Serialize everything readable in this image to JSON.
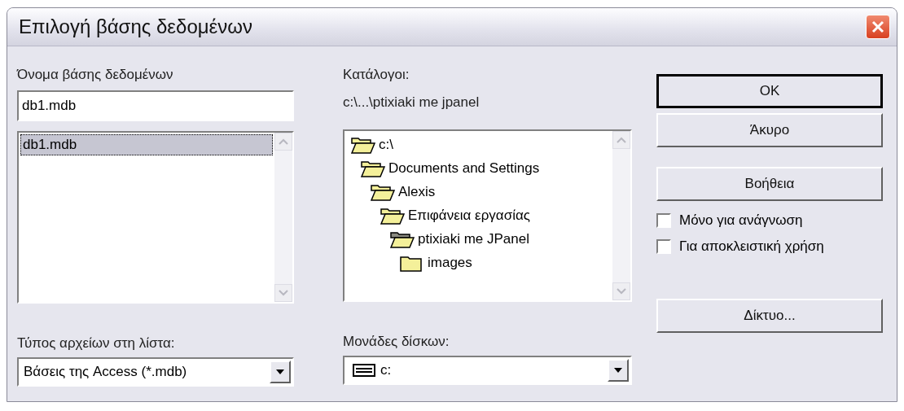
{
  "window": {
    "title": "Επιλογή βάσης δεδομένων"
  },
  "database_name": {
    "label": "Όνομα βάσης δεδομένων",
    "value": "db1.mdb",
    "files": [
      {
        "label": "db1.mdb",
        "selected": true
      }
    ]
  },
  "directories": {
    "label": "Κατάλογοι:",
    "path": "c:\\...\\ptixiaki me jpanel",
    "tree": [
      {
        "label": "c:\\",
        "kind": "open",
        "children": [
          {
            "label": "Documents and Settings",
            "kind": "open",
            "children": [
              {
                "label": "Alexis",
                "kind": "open",
                "children": [
                  {
                    "label": "Επιφάνεια εργασίας",
                    "kind": "open",
                    "children": [
                      {
                        "label": "ptixiaki me JPanel",
                        "kind": "current",
                        "children": [
                          {
                            "label": "images",
                            "kind": "closed"
                          }
                        ]
                      }
                    ]
                  }
                ]
              }
            ]
          }
        ]
      }
    ]
  },
  "file_type": {
    "label": "Τύπος αρχείων στη λίστα:",
    "value": "Βάσεις της Access (*.mdb)"
  },
  "drives": {
    "label": "Μονάδες δίσκων:",
    "value": "c:"
  },
  "buttons": [
    {
      "label": "OK",
      "default": true
    },
    {
      "label": "Άκυρο",
      "default": false
    },
    {
      "label": "Βοήθεια",
      "default": false
    }
  ],
  "options": [
    {
      "label": "Μόνο για ανάγνωση",
      "checked": false
    },
    {
      "label": "Για αποκλειστική χρήση",
      "checked": false
    }
  ],
  "network_button": {
    "label": "Δίκτυο..."
  }
}
